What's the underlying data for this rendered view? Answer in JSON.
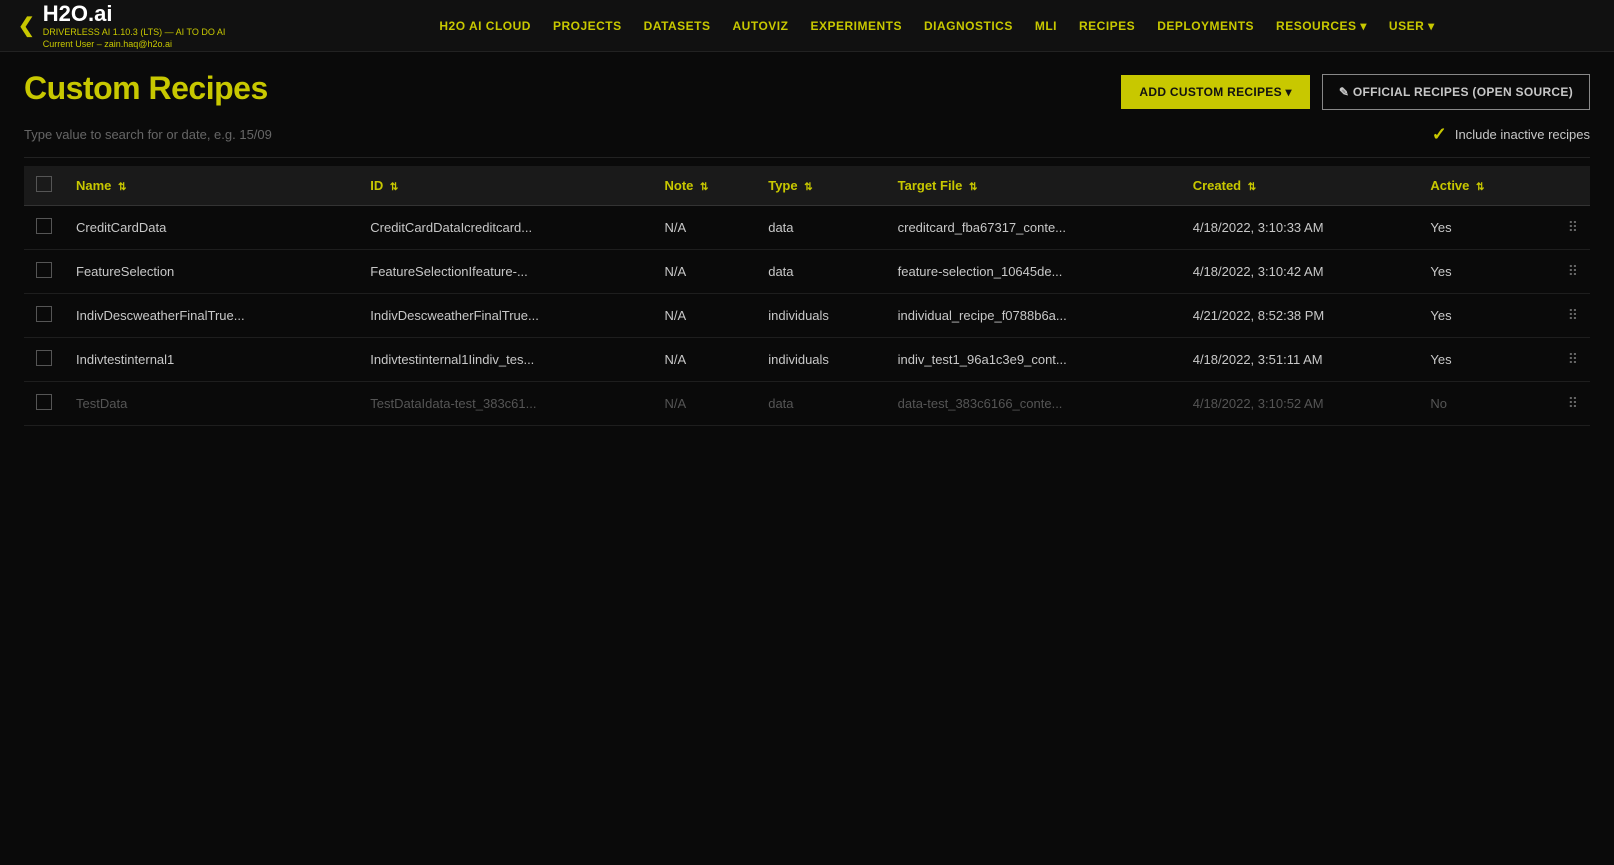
{
  "brand": {
    "chevron": "❮",
    "name": "H2O.ai",
    "subtitle_line1": "DRIVERLESS AI 1.10.3 (LTS) — AI TO DO AI",
    "subtitle_line2": "Current User – zain.haq@h2o.ai"
  },
  "nav": {
    "links": [
      {
        "label": "H2O AI CLOUD"
      },
      {
        "label": "PROJECTS"
      },
      {
        "label": "DATASETS"
      },
      {
        "label": "AUTOVIZ"
      },
      {
        "label": "EXPERIMENTS"
      },
      {
        "label": "DIAGNOSTICS"
      },
      {
        "label": "MLI"
      },
      {
        "label": "RECIPES"
      },
      {
        "label": "DEPLOYMENTS"
      },
      {
        "label": "RESOURCES ▾"
      },
      {
        "label": "USER ▾"
      }
    ]
  },
  "page": {
    "title": "Custom Recipes",
    "add_custom_label": "ADD CUSTOM RECIPES ▾",
    "official_label": "✎ OFFICIAL RECIPES (OPEN SOURCE)"
  },
  "search": {
    "placeholder": "Type value to search for or date, e.g. 15/09",
    "include_inactive_label": "Include inactive recipes"
  },
  "table": {
    "columns": [
      {
        "key": "check",
        "label": ""
      },
      {
        "key": "name",
        "label": "Name"
      },
      {
        "key": "id",
        "label": "ID"
      },
      {
        "key": "note",
        "label": "Note"
      },
      {
        "key": "type",
        "label": "Type"
      },
      {
        "key": "target_file",
        "label": "Target File"
      },
      {
        "key": "created",
        "label": "Created"
      },
      {
        "key": "active",
        "label": "Active"
      },
      {
        "key": "actions",
        "label": ""
      }
    ],
    "rows": [
      {
        "name": "CreditCardData",
        "id": "CreditCardDataIcreditcard...",
        "note": "N/A",
        "type": "data",
        "target_file": "creditcard_fba67317_conte...",
        "created": "4/18/2022, 3:10:33 AM",
        "active": "Yes",
        "inactive": false
      },
      {
        "name": "FeatureSelection",
        "id": "FeatureSelectionIfeature-...",
        "note": "N/A",
        "type": "data",
        "target_file": "feature-selection_10645de...",
        "created": "4/18/2022, 3:10:42 AM",
        "active": "Yes",
        "inactive": false
      },
      {
        "name": "IndivDescweatherFinalTrue...",
        "id": "IndivDescweatherFinalTrue...",
        "note": "N/A",
        "type": "individuals",
        "target_file": "individual_recipe_f0788b6a...",
        "created": "4/21/2022, 8:52:38 PM",
        "active": "Yes",
        "inactive": false
      },
      {
        "name": "Indivtestinternal1",
        "id": "Indivtestinternal1Iindiv_tes...",
        "note": "N/A",
        "type": "individuals",
        "target_file": "indiv_test1_96a1c3e9_cont...",
        "created": "4/18/2022, 3:51:11 AM",
        "active": "Yes",
        "inactive": false
      },
      {
        "name": "TestData",
        "id": "TestDataIdata-test_383c61...",
        "note": "N/A",
        "type": "data",
        "target_file": "data-test_383c6166_conte...",
        "created": "4/18/2022, 3:10:52 AM",
        "active": "No",
        "inactive": true
      }
    ]
  }
}
